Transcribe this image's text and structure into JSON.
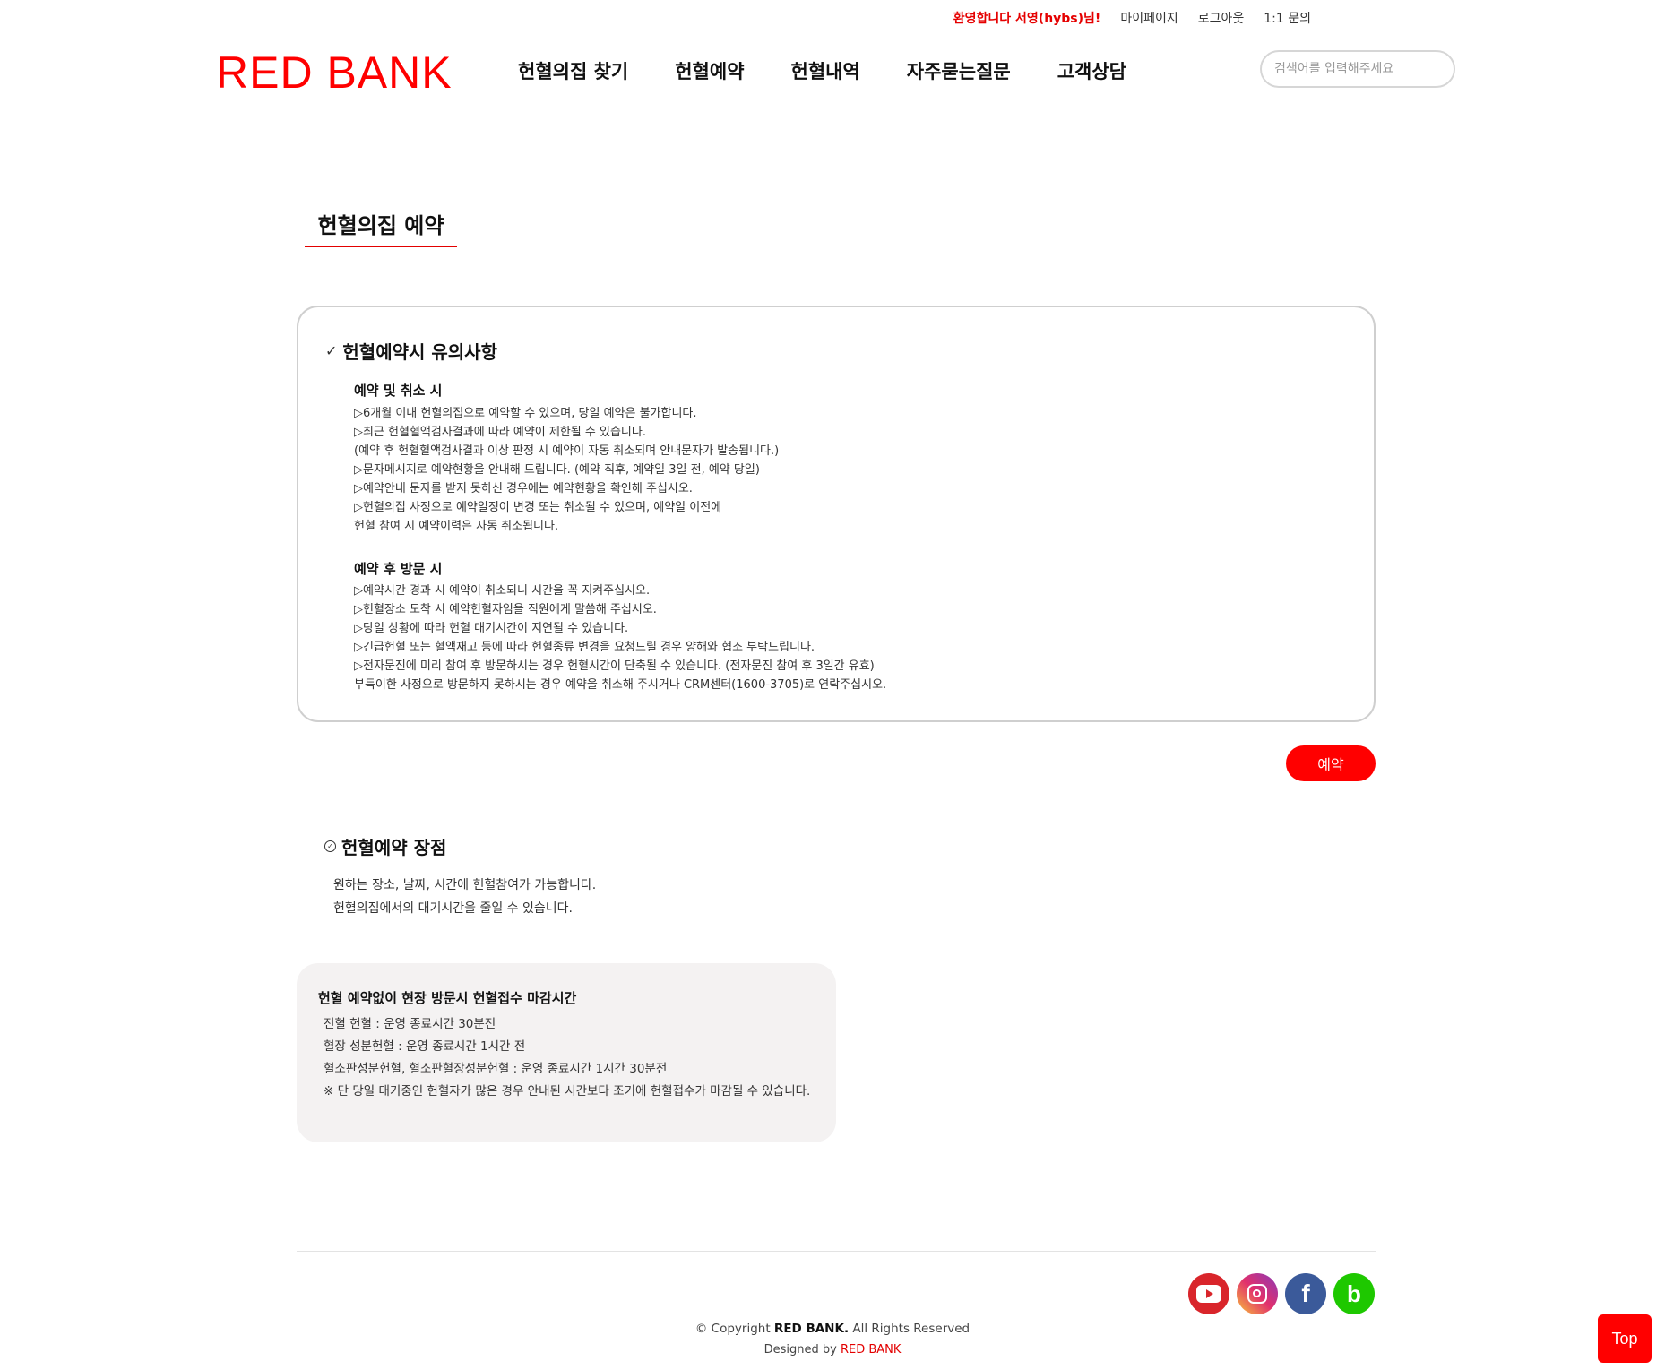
{
  "header": {
    "welcome": "환영합니다 서영(hybs)님!",
    "links": [
      "마이페이지",
      "로그아웃",
      "1:1 문의"
    ],
    "logo": "RED BANK",
    "nav": [
      "헌혈의집 찾기",
      "헌혈예약",
      "헌혈내역",
      "자주묻는질문",
      "고객상담"
    ],
    "search_placeholder": "검색어를 입력해주세요"
  },
  "page_title": "헌혈의집 예약",
  "notice": {
    "heading": "헌혈예약시 유의사항",
    "sections": [
      {
        "title": "예약 및 취소 시",
        "lines": [
          "▷6개월 이내 헌혈의집으로 예약할 수 있으며, 당일 예약은 불가합니다.",
          "▷최근 헌혈혈액검사결과에 따라 예약이 제한될 수 있습니다.",
          "(예약 후 헌혈혈액검사결과 이상 판정 시 예약이 자동 취소되며 안내문자가 발송됩니다.)",
          "▷문자메시지로 예약현황을 안내해 드립니다. (예약 직후, 예약일 3일 전, 예약 당일)",
          "▷예약안내 문자를 받지 못하신 경우에는 예약현황을 확인해 주십시오.",
          "▷헌혈의집 사정으로 예약일정이 변경 또는 취소될 수 있으며, 예약일 이전에",
          "헌혈 참여 시 예약이력은 자동 취소됩니다."
        ]
      },
      {
        "title": "예약 후 방문 시",
        "lines": [
          "▷예약시간 경과 시 예약이 취소되니 시간을 꼭 지켜주십시오.",
          "▷헌혈장소 도착 시 예약헌혈자임을 직원에게 말씀해 주십시오.",
          "▷당일 상황에 따라 헌혈 대기시간이 지연될 수 있습니다.",
          "▷긴급헌혈 또는 혈액재고 등에 따라 헌혈종류 변경을 요청드릴 경우 양해와 협조 부탁드립니다.",
          "▷전자문진에 미리 참여 후 방문하시는 경우 헌혈시간이 단축될 수 있습니다. (전자문진 참여 후 3일간 유효)",
          "부득이한 사정으로 방문하지 못하시는 경우 예약을 취소해 주시거나 CRM센터(1600-3705)로 연락주십시오."
        ]
      }
    ]
  },
  "reserve_button": "예약",
  "merits": {
    "heading": "헌혈예약 장점",
    "lines": [
      "원하는 장소, 날짜, 시간에 헌혈참여가 가능합니다.",
      "헌혈의집에서의 대기시간을 줄일 수 있습니다."
    ]
  },
  "deadline": {
    "title": "헌혈 예약없이 현장 방문시 헌혈접수 마감시간",
    "lines": [
      "전혈 헌혈 : 운영 종료시간 30분전",
      "혈장 성분헌혈 : 운영 종료시간 1시간 전",
      "혈소판성분헌혈, 혈소판혈장성분헌혈 : 운영 종료시간 1시간 30분전",
      "※ 단 당일 대기중인 헌혈자가 많은 경우 안내된 시간보다 조기에 헌혈접수가 마감될 수 있습니다."
    ]
  },
  "footer": {
    "sns": [
      "youtube-icon",
      "instagram-icon",
      "facebook-icon",
      "band-icon"
    ],
    "facebook_glyph": "f",
    "band_glyph": "b",
    "copyright_prefix": "© Copyright ",
    "copyright_brand": "RED BANK.",
    "copyright_suffix": " All Rights Reserved",
    "designed_prefix": "Designed by ",
    "designed_brand": "RED BANK"
  },
  "top_button": "Top",
  "colors": {
    "accent": "#ff0000",
    "box_bg": "#f4f2f2",
    "border": "#cfcfcf"
  }
}
